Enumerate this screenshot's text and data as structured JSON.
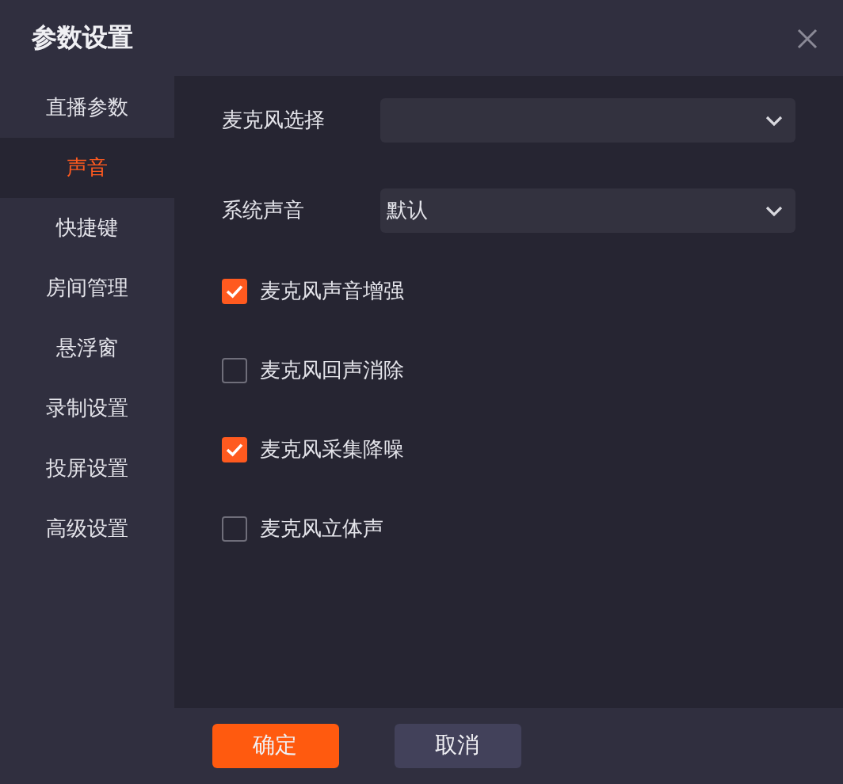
{
  "window": {
    "title": "参数设置"
  },
  "sidebar": {
    "items": [
      {
        "label": "直播参数",
        "selected": false
      },
      {
        "label": "声音",
        "selected": true
      },
      {
        "label": "快捷键",
        "selected": false
      },
      {
        "label": "房间管理",
        "selected": false
      },
      {
        "label": "悬浮窗",
        "selected": false
      },
      {
        "label": "录制设置",
        "selected": false
      },
      {
        "label": "投屏设置",
        "selected": false
      },
      {
        "label": "高级设置",
        "selected": false
      }
    ]
  },
  "selects": [
    {
      "label": "麦克风选择"
    },
    {
      "label": "系统声音",
      "value": "默认"
    }
  ],
  "checkboxes": [
    {
      "label": "麦克风声音增强",
      "checked": true
    },
    {
      "label": "麦克风回声消除",
      "checked": false
    },
    {
      "label": "麦克风采集降噪",
      "checked": true
    },
    {
      "label": "麦克风立体声",
      "checked": false
    }
  ],
  "buttons": [
    {
      "label": "确定",
      "kind": "primary"
    },
    {
      "label": "取消",
      "kind": "secondary"
    }
  ]
}
